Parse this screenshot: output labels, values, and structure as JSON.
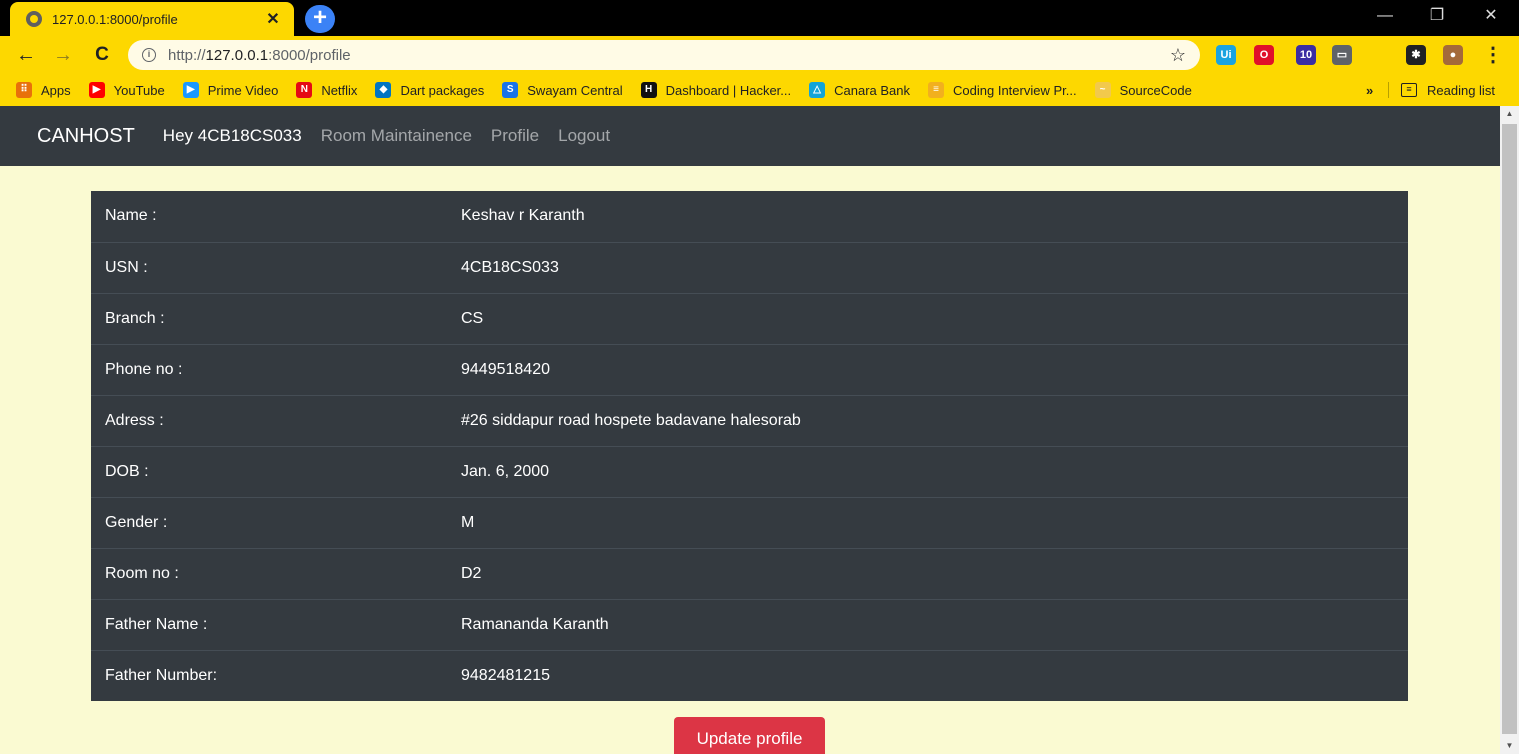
{
  "browser": {
    "tab_title": "127.0.0.1:8000/profile",
    "tab_close": "✕",
    "new_tab": "+",
    "window_controls": {
      "minimize": "—",
      "restore": "❐",
      "close": "✕"
    },
    "url_prefix": "http://",
    "url_host": "127.0.0.1",
    "url_rest": ":8000/profile",
    "nav": {
      "back": "←",
      "forward": "→",
      "reload": "C"
    },
    "star": "☆",
    "menu": "⋮",
    "extensions": [
      {
        "name": "uipath-extension-icon",
        "label": "Ui",
        "color": "#1aa3e0"
      },
      {
        "name": "opera-extension-icon",
        "label": "O",
        "color": "#e0102a"
      },
      {
        "name": "graduation-extension-icon",
        "label": "10",
        "color": "#3b2ea3"
      },
      {
        "name": "cast-extension-icon",
        "label": "▭",
        "color": "#5f6368"
      },
      {
        "name": "puzzle-extension-icon",
        "label": "✱",
        "color": "#202124"
      },
      {
        "name": "profile-avatar-icon",
        "label": "●",
        "color": "#a46a3a"
      }
    ]
  },
  "bookmarks": {
    "items": [
      {
        "label": "Apps",
        "icon": "apps-grid-icon",
        "glyph": "⠿",
        "color": "#e8710a"
      },
      {
        "label": "YouTube",
        "icon": "youtube-icon",
        "glyph": "▶",
        "color": "#ff0000"
      },
      {
        "label": "Prime Video",
        "icon": "prime-video-icon",
        "glyph": "▶",
        "color": "#1a98ff"
      },
      {
        "label": "Netflix",
        "icon": "netflix-icon",
        "glyph": "N",
        "color": "#e50914"
      },
      {
        "label": "Dart packages",
        "icon": "dart-icon",
        "glyph": "◆",
        "color": "#0175c2"
      },
      {
        "label": "Swayam Central",
        "icon": "swayam-icon",
        "glyph": "S",
        "color": "#1a73e8"
      },
      {
        "label": "Dashboard | Hacker...",
        "icon": "hackerrank-icon",
        "glyph": "H",
        "color": "#111111"
      },
      {
        "label": "Canara Bank",
        "icon": "canara-bank-icon",
        "glyph": "△",
        "color": "#12a4d9"
      },
      {
        "label": "Coding Interview Pr...",
        "icon": "coding-interview-icon",
        "glyph": "≡",
        "color": "#f2b01e"
      },
      {
        "label": "SourceCode",
        "icon": "sourcecode-icon",
        "glyph": "~",
        "color": "#f2c94c"
      }
    ],
    "overflow": "»",
    "reading_list": "Reading list"
  },
  "navbar": {
    "brand": "CANHOST",
    "greeting": "Hey 4CB18CS033",
    "links": [
      "Room Maintainence",
      "Profile",
      "Logout"
    ]
  },
  "profile": {
    "rows": [
      {
        "label": "Name :",
        "value": "Keshav r Karanth"
      },
      {
        "label": "USN :",
        "value": "4CB18CS033"
      },
      {
        "label": "Branch :",
        "value": "CS"
      },
      {
        "label": "Phone no :",
        "value": "9449518420"
      },
      {
        "label": "Adress :",
        "value": "#26 siddapur road hospete badavane halesorab"
      },
      {
        "label": "DOB :",
        "value": "Jan. 6, 2000"
      },
      {
        "label": "Gender :",
        "value": "M"
      },
      {
        "label": "Room no :",
        "value": "D2"
      },
      {
        "label": "Father Name :",
        "value": "Ramananda Karanth"
      },
      {
        "label": "Father Number:",
        "value": "9482481215"
      }
    ],
    "update_button": "Update profile"
  },
  "colors": {
    "browser_theme": "#fdd800",
    "navbar_bg": "#343a40",
    "page_bg": "#fafad2",
    "danger": "#dc3545"
  }
}
